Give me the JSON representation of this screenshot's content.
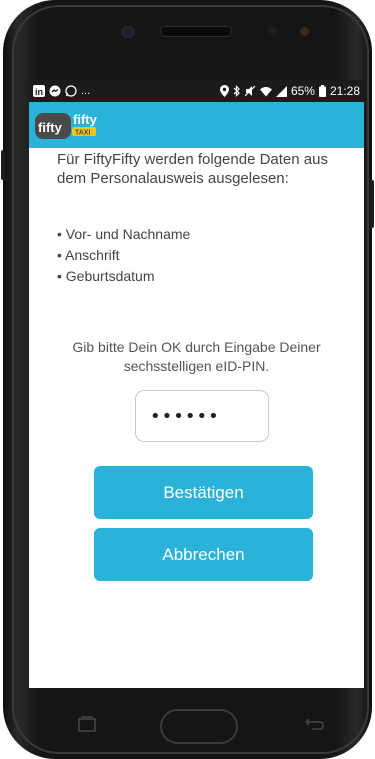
{
  "status_bar": {
    "left_icons": [
      "linkedin-icon",
      "messenger-icon",
      "whatsapp-icon"
    ],
    "overflow": "...",
    "battery": "65%",
    "time": "21:28"
  },
  "app": {
    "logo_word1": "fifty",
    "logo_word2": "fifty",
    "logo_badge": "TAXI",
    "accent_color": "#2bb2d8"
  },
  "content": {
    "intro": "Für FiftyFifty werden folgende Daten aus dem Personalausweis ausgelesen:",
    "items": [
      "Vor- und Nachname",
      "Anschrift",
      "Geburtsdatum"
    ],
    "instruction": "Gib bitte Dein OK durch Eingabe Deiner sechsstelligen eID-PIN.",
    "pin_value": "••••••"
  },
  "buttons": {
    "confirm": "Bestätigen",
    "cancel": "Abbrechen"
  }
}
